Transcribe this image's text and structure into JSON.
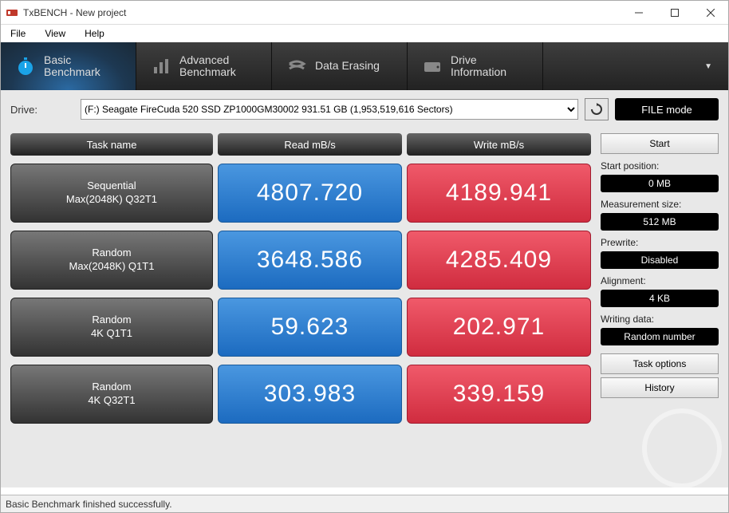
{
  "window": {
    "title": "TxBENCH - New project"
  },
  "menu": {
    "file": "File",
    "view": "View",
    "help": "Help"
  },
  "tabs": {
    "basic": "Basic\nBenchmark",
    "advanced": "Advanced\nBenchmark",
    "erase": "Data Erasing",
    "info": "Drive\nInformation"
  },
  "drive": {
    "label": "Drive:",
    "selected": "(F:) Seagate FireCuda 520 SSD ZP1000GM30002  931.51 GB (1,953,519,616 Sectors)",
    "filemode": "FILE mode"
  },
  "headers": {
    "task": "Task name",
    "read": "Read mB/s",
    "write": "Write mB/s"
  },
  "results": [
    {
      "name1": "Sequential",
      "name2": "Max(2048K) Q32T1",
      "read": "4807.720",
      "write": "4189.941"
    },
    {
      "name1": "Random",
      "name2": "Max(2048K) Q1T1",
      "read": "3648.586",
      "write": "4285.409"
    },
    {
      "name1": "Random",
      "name2": "4K Q1T1",
      "read": "59.623",
      "write": "202.971"
    },
    {
      "name1": "Random",
      "name2": "4K Q32T1",
      "read": "303.983",
      "write": "339.159"
    }
  ],
  "side": {
    "start": "Start",
    "startpos_label": "Start position:",
    "startpos_value": "0 MB",
    "msize_label": "Measurement size:",
    "msize_value": "512 MB",
    "prewrite_label": "Prewrite:",
    "prewrite_value": "Disabled",
    "align_label": "Alignment:",
    "align_value": "4 KB",
    "wdata_label": "Writing data:",
    "wdata_value": "Random number",
    "btn_task": "Task options",
    "btn_history": "History"
  },
  "status": "Basic Benchmark finished successfully."
}
